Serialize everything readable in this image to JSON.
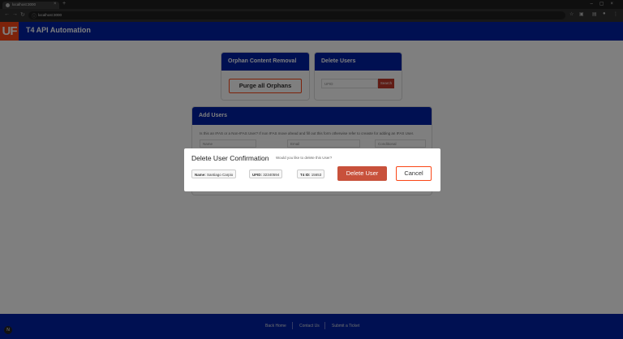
{
  "browser": {
    "tab_title": "localhost:3000",
    "url": "localhost:3000"
  },
  "app": {
    "logo": "UF",
    "title": "T4 API Automation",
    "brand_color": "#0021a5",
    "accent_color": "#fa4616"
  },
  "cards": {
    "orphan": {
      "title": "Orphan Content Removal",
      "button": "Purge all Orphans"
    },
    "delete_users": {
      "title": "Delete Users",
      "input_placeholder": "UFID",
      "button": "Search"
    },
    "add_users": {
      "title": "Add Users",
      "description": "Is this an IFAS or a Non-IFAS User? If non IFAS move ahead and fill out this form otherwise refer to creaste for adding an IFAS User.",
      "field1": "Name",
      "field2": "Email",
      "field3": "Conditional"
    }
  },
  "modal": {
    "title": "Delete User Confirmation",
    "subtitle": "Would you like to delete this User?",
    "name_label": "Name:",
    "name_value": "Santiago Carpio",
    "ufid_label": "UFID:",
    "ufid_value": "32340594",
    "t4id_label": "T4 ID:",
    "t4id_value": "15653",
    "delete_button": "Delete User",
    "cancel_button": "Cancel"
  },
  "footer": {
    "links": [
      "Back Home",
      "Contact Us",
      "Submit a Ticket"
    ]
  },
  "corner_badge": "N"
}
